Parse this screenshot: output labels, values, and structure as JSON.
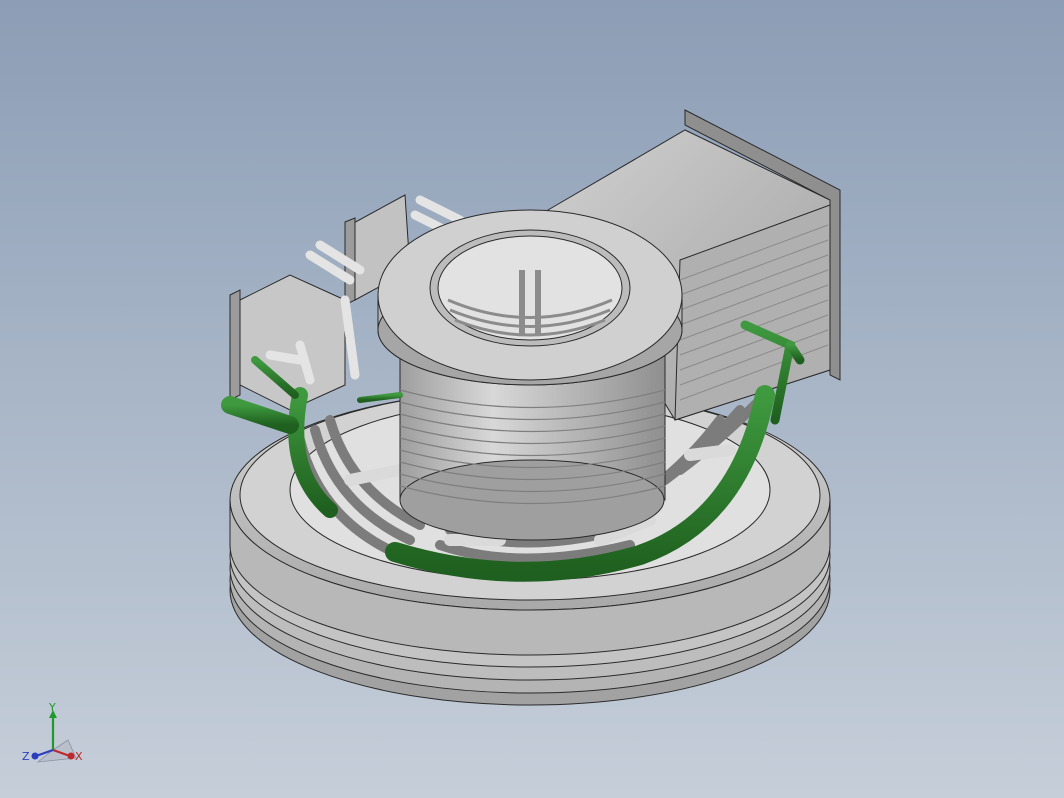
{
  "viewport": {
    "background_top": "#8c9db5",
    "background_bottom": "#c6ced9"
  },
  "model": {
    "body_color": "#c8c8c8",
    "shade_color": "#9a9a9a",
    "pipe_color": "#2e7a2e",
    "edge_color": "#2a2a2a"
  },
  "triad": {
    "x_label": "X",
    "y_label": "Y",
    "z_label": "Z",
    "x_color": "#c0282d",
    "y_color": "#1e9a2a",
    "z_color": "#2a3fbf"
  }
}
